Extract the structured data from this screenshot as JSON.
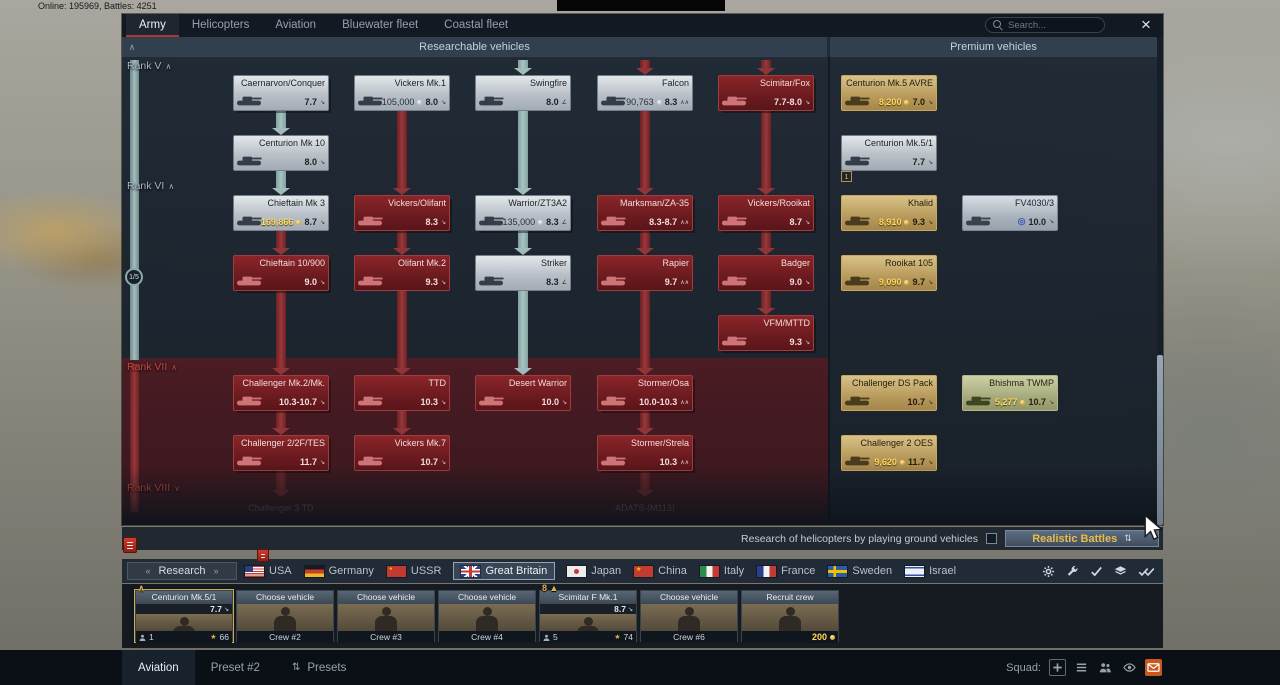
{
  "topbar": {
    "online": "Online: 195969, Battles: 4251"
  },
  "tabs": {
    "items": [
      {
        "id": "army",
        "label": "Army",
        "active": true
      },
      {
        "id": "helicopters",
        "label": "Helicopters"
      },
      {
        "id": "aviation",
        "label": "Aviation"
      },
      {
        "id": "bluewater-fleet",
        "label": "Bluewater fleet"
      },
      {
        "id": "coastal-fleet",
        "label": "Coastal fleet"
      }
    ],
    "search_placeholder": "Search..."
  },
  "icons": {
    "close": "×",
    "collapse": "∧",
    "research_left": "«",
    "research_right": "»",
    "mode_sort": "⇅",
    "medal": "★"
  },
  "headers": {
    "researchable": "Researchable vehicles",
    "premium": "Premium vehicles"
  },
  "ranks": [
    {
      "label": "Rank V",
      "chevron": "∧",
      "tone": "normal"
    },
    {
      "label": "Rank VI",
      "chevron": "∧",
      "tone": "normal"
    },
    {
      "label": "Rank VII",
      "chevron": "∧",
      "tone": "locked"
    },
    {
      "label": "Rank VIII",
      "chevron": "∨",
      "tone": "locked"
    }
  ],
  "rank_progress_badge": "1/5",
  "tree": {
    "vehicles": [
      {
        "name": "Caernarvon/Conquer",
        "br": "7.7",
        "br_icon": "↘",
        "col": 0,
        "row": 0,
        "state": "researched",
        "folder": true
      },
      {
        "name": "Vickers Mk.1",
        "price": "105,000",
        "currency": "silver",
        "br": "8.0",
        "br_icon": "↘",
        "col": 1,
        "row": 0,
        "state": "researched"
      },
      {
        "name": "Swingfire",
        "br": "8.0",
        "br_icon": "∠",
        "col": 2,
        "row": 0,
        "state": "researched"
      },
      {
        "name": "Falcon",
        "price": "90,763",
        "currency": "silver",
        "br": "8.3",
        "br_icon": "∧∧",
        "col": 3,
        "row": 0,
        "state": "researched"
      },
      {
        "name": "Scimitar/Fox",
        "br": "7.7-8.0",
        "br_icon": "↘",
        "col": 4,
        "row": 0,
        "state": "locked",
        "folder": true
      },
      {
        "name": "Centurion Mk 10",
        "br": "8.0",
        "br_icon": "↘",
        "col": 0,
        "row": 1,
        "state": "researched"
      },
      {
        "name": "Chieftain Mk 3",
        "price": "169,866",
        "currency": "gold",
        "br": "8.7",
        "br_icon": "↘",
        "col": 0,
        "row": 2,
        "state": "researched"
      },
      {
        "name": "Vickers/Olifant",
        "br": "8.3",
        "br_icon": "↘",
        "col": 1,
        "row": 2,
        "state": "locked",
        "folder": true
      },
      {
        "name": "Warrior/ZT3A2",
        "price": "135,000",
        "currency": "silver",
        "br": "8.3",
        "br_icon": "∠",
        "col": 2,
        "row": 2,
        "state": "researched",
        "folder": true
      },
      {
        "name": "Marksman/ZA-35",
        "br": "8.3-8.7",
        "br_icon": "∧∧",
        "col": 3,
        "row": 2,
        "state": "locked",
        "folder": true
      },
      {
        "name": "Vickers/Rooikat",
        "br": "8.7",
        "br_icon": "↘",
        "col": 4,
        "row": 2,
        "state": "locked",
        "folder": true
      },
      {
        "name": "Chieftain 10/900",
        "br": "9.0",
        "br_icon": "↘",
        "col": 0,
        "row": 3,
        "state": "locked",
        "folder": true
      },
      {
        "name": "Olifant Mk.2",
        "br": "9.3",
        "br_icon": "↘",
        "col": 1,
        "row": 3,
        "state": "locked"
      },
      {
        "name": "Striker",
        "br": "8.3",
        "br_icon": "∠",
        "col": 2,
        "row": 3,
        "state": "researched"
      },
      {
        "name": "Rapier",
        "br": "9.7",
        "br_icon": "∧∧",
        "col": 3,
        "row": 3,
        "state": "locked"
      },
      {
        "name": "Badger",
        "br": "9.0",
        "br_icon": "↘",
        "col": 4,
        "row": 3,
        "state": "locked"
      },
      {
        "name": "VFM/MTTD",
        "br": "9.3",
        "br_icon": "↘",
        "col": 4,
        "row": 4,
        "state": "locked",
        "folder": true
      },
      {
        "name": "Challenger Mk.2/Mk.",
        "br": "10.3-10.7",
        "br_icon": "↘",
        "col": 0,
        "row": 5,
        "state": "locked",
        "folder": true
      },
      {
        "name": "TTD",
        "br": "10.3",
        "br_icon": "↘",
        "col": 1,
        "row": 5,
        "state": "locked"
      },
      {
        "name": "Desert Warrior",
        "br": "10.0",
        "br_icon": "↘",
        "col": 2,
        "row": 5,
        "state": "locked"
      },
      {
        "name": "Stormer/Osa",
        "br": "10.0-10.3",
        "br_icon": "∧∧",
        "col": 3,
        "row": 5,
        "state": "locked",
        "folder": true
      },
      {
        "name": "Challenger 2/2F/TES",
        "br": "11.7",
        "br_icon": "↘",
        "col": 0,
        "row": 6,
        "state": "locked",
        "folder": true
      },
      {
        "name": "Vickers Mk.7",
        "br": "10.7",
        "br_icon": "↘",
        "col": 1,
        "row": 6,
        "state": "locked"
      },
      {
        "name": "Stormer/Strela",
        "br": "10.3",
        "br_icon": "∧∧",
        "col": 3,
        "row": 6,
        "state": "locked",
        "folder": true
      },
      {
        "name": "Challenger 3 TD",
        "col": 0,
        "row": 7,
        "state": "faded"
      },
      {
        "name": "ADATS (M113)",
        "col": 3,
        "row": 7,
        "state": "faded"
      },
      {
        "name": "Centurion Mk.5 AVRE",
        "price": "8,200",
        "currency": "gold",
        "br": "7.0",
        "br_icon": "↘",
        "col": 5,
        "row": 0,
        "state": "premium"
      },
      {
        "name": "Centurion Mk.5/1",
        "br": "7.7",
        "br_icon": "↘",
        "col": 5,
        "row": 1,
        "state": "owned",
        "badge": "1"
      },
      {
        "name": "Khalid",
        "price": "8,910",
        "currency": "gold",
        "br": "9.3",
        "br_icon": "↘",
        "col": 5,
        "row": 2,
        "state": "premium"
      },
      {
        "name": "FV4030/3",
        "prefix_icon": "◎",
        "br": "10.0",
        "br_icon": "↘",
        "col": 6,
        "row": 2,
        "state": "market"
      },
      {
        "name": "Rooikat 105",
        "price": "9,090",
        "currency": "gold",
        "br": "9.7",
        "br_icon": "↘",
        "col": 5,
        "row": 3,
        "state": "premium"
      },
      {
        "name": "Challenger DS Pack",
        "br": "10.7",
        "br_icon": "↘",
        "col": 5,
        "row": 5,
        "state": "premium"
      },
      {
        "name": "Bhishma TWMP",
        "price": "5,277",
        "currency": "gold",
        "br": "10.7",
        "br_icon": "↘",
        "col": 6,
        "row": 5,
        "state": "owned-premium"
      },
      {
        "name": "Challenger 2 OES",
        "price": "9,620",
        "currency": "gold",
        "br": "11.7",
        "br_icon": "↘",
        "col": 5,
        "row": 6,
        "state": "premium"
      }
    ],
    "arrows": [
      {
        "col": 0,
        "from": 0,
        "to": 1,
        "tone": "teal"
      },
      {
        "col": 0,
        "from": 1,
        "to": 2,
        "tone": "teal"
      },
      {
        "col": 0,
        "from": 2,
        "to": 3,
        "tone": "red"
      },
      {
        "col": 0,
        "from": 3,
        "to": 5,
        "tone": "red"
      },
      {
        "col": 0,
        "from": 5,
        "to": 6,
        "tone": "red"
      },
      {
        "col": 0,
        "from": 6,
        "to": 7,
        "tone": "red",
        "faded": true
      },
      {
        "col": 1,
        "from": 0,
        "to": 2,
        "tone": "red"
      },
      {
        "col": 1,
        "from": 2,
        "to": 3,
        "tone": "red"
      },
      {
        "col": 1,
        "from": 3,
        "to": 5,
        "tone": "red"
      },
      {
        "col": 1,
        "from": 5,
        "to": 6,
        "tone": "red"
      },
      {
        "col": 2,
        "stub": true,
        "tone": "teal"
      },
      {
        "col": 2,
        "from": 0,
        "to": 2,
        "tone": "teal"
      },
      {
        "col": 2,
        "from": 2,
        "to": 3,
        "tone": "teal"
      },
      {
        "col": 2,
        "from": 3,
        "to": 5,
        "tone": "teal"
      },
      {
        "col": 3,
        "stub": true,
        "tone": "red"
      },
      {
        "col": 3,
        "from": 0,
        "to": 2,
        "tone": "red"
      },
      {
        "col": 3,
        "from": 2,
        "to": 3,
        "tone": "red"
      },
      {
        "col": 3,
        "from": 3,
        "to": 5,
        "tone": "red"
      },
      {
        "col": 3,
        "from": 5,
        "to": 6,
        "tone": "red"
      },
      {
        "col": 3,
        "from": 6,
        "to": 7,
        "tone": "red",
        "faded": true
      },
      {
        "col": 4,
        "stub": true,
        "tone": "red"
      },
      {
        "col": 4,
        "from": 0,
        "to": 2,
        "tone": "red"
      },
      {
        "col": 4,
        "from": 2,
        "to": 3,
        "tone": "red"
      },
      {
        "col": 4,
        "from": 3,
        "to": 4,
        "tone": "red"
      }
    ]
  },
  "heli_row": {
    "text": "Research of helicopters by playing ground vehicles",
    "mode": "Realistic Battles"
  },
  "nation_bar": {
    "research_label": "Research",
    "nations": [
      {
        "name": "USA",
        "flag": "usa"
      },
      {
        "name": "Germany",
        "flag": "germany"
      },
      {
        "name": "USSR",
        "flag": "ussr"
      },
      {
        "name": "Great Britain",
        "flag": "gb",
        "active": true
      },
      {
        "name": "Japan",
        "flag": "japan"
      },
      {
        "name": "China",
        "flag": "china"
      },
      {
        "name": "Italy",
        "flag": "italy"
      },
      {
        "name": "France",
        "flag": "france"
      },
      {
        "name": "Sweden",
        "flag": "sweden"
      },
      {
        "name": "Israel",
        "flag": "israel"
      }
    ],
    "tool_icons": [
      {
        "name": "gear-icon"
      },
      {
        "name": "wrench-icon"
      },
      {
        "name": "check-icon"
      },
      {
        "name": "layers-icon"
      },
      {
        "name": "double-check-icon"
      }
    ]
  },
  "crew": {
    "slots": [
      {
        "type": "vehicle",
        "name": "Centurion Mk.5/1",
        "br": "7.7",
        "br_icon": "↘",
        "foot_left": "1",
        "foot_right": "66",
        "top_badge": "∧",
        "selected": true
      },
      {
        "type": "empty",
        "name": "Choose vehicle",
        "crew_label": "Crew #2"
      },
      {
        "type": "empty",
        "name": "Choose vehicle",
        "crew_label": "Crew #3"
      },
      {
        "type": "empty",
        "name": "Choose vehicle",
        "crew_label": "Crew #4"
      },
      {
        "type": "vehicle",
        "name": "Scimitar F Mk.1",
        "br": "8.7",
        "br_icon": "↘",
        "foot_left": "5",
        "foot_right": "74",
        "top_badge": "8 ▲"
      },
      {
        "type": "empty",
        "name": "Choose vehicle",
        "crew_label": "Crew #6"
      },
      {
        "type": "recruit",
        "name": "Recruit crew",
        "price": "200",
        "currency": "gold"
      }
    ]
  },
  "bottom_bar": {
    "tabs": [
      {
        "label": "Aviation",
        "active": true
      },
      {
        "label": "Preset #2"
      },
      {
        "label": "Presets",
        "icon": "⇅"
      }
    ],
    "squad_label": "Squad:",
    "icons": [
      {
        "name": "plus-icon"
      },
      {
        "name": "list-icon"
      },
      {
        "name": "people-icon"
      },
      {
        "name": "eye-icon"
      },
      {
        "name": "mail-icon",
        "highlight": true
      }
    ]
  },
  "colors": {
    "accent_gold": "#e3b44a",
    "locked_red": "#7e2227",
    "teal_path": "#9db9b9",
    "mail_highlight": "#c9581f"
  }
}
